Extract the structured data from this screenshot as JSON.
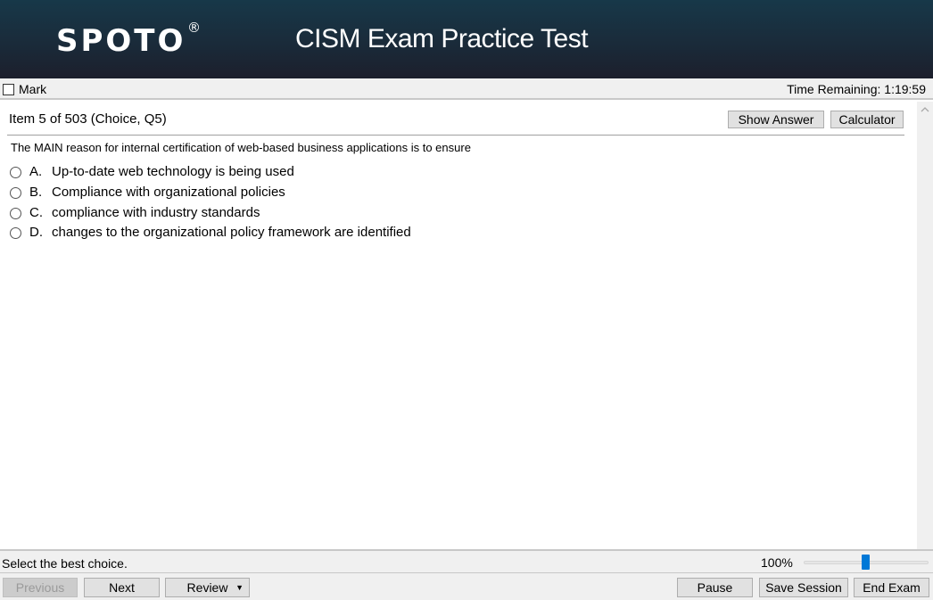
{
  "header": {
    "logo": "SPOTO",
    "logo_mark": "®",
    "title": "CISM Exam Practice Test"
  },
  "toolbar": {
    "mark_label": "Mark",
    "mark_checked": false,
    "time_remaining": "Time Remaining: 1:19:59"
  },
  "item": {
    "title": "Item 5 of 503 (Choice, Q5)",
    "show_answer_label": "Show Answer",
    "calculator_label": "Calculator",
    "question": "The MAIN reason for internal certification of web-based business applications is to ensure",
    "options": [
      {
        "letter": "A.",
        "text": "Up-to-date web technology is being used",
        "selected": false
      },
      {
        "letter": "B.",
        "text": "Compliance with organizational policies",
        "selected": false
      },
      {
        "letter": "C.",
        "text": "compliance with industry standards",
        "selected": false
      },
      {
        "letter": "D.",
        "text": "changes to the organizational policy framework are identified",
        "selected": false
      }
    ]
  },
  "scrollbar": {
    "up_icon": "chevron-up-icon"
  },
  "status": {
    "instruction": "Select the best choice.",
    "zoom_label": "100%",
    "zoom_value_percent": 100
  },
  "nav": {
    "previous_label": "Previous",
    "previous_disabled": true,
    "next_label": "Next",
    "review_label": "Review",
    "review_caret": "▼",
    "pause_label": "Pause",
    "save_session_label": "Save Session",
    "end_exam_label": "End Exam"
  }
}
